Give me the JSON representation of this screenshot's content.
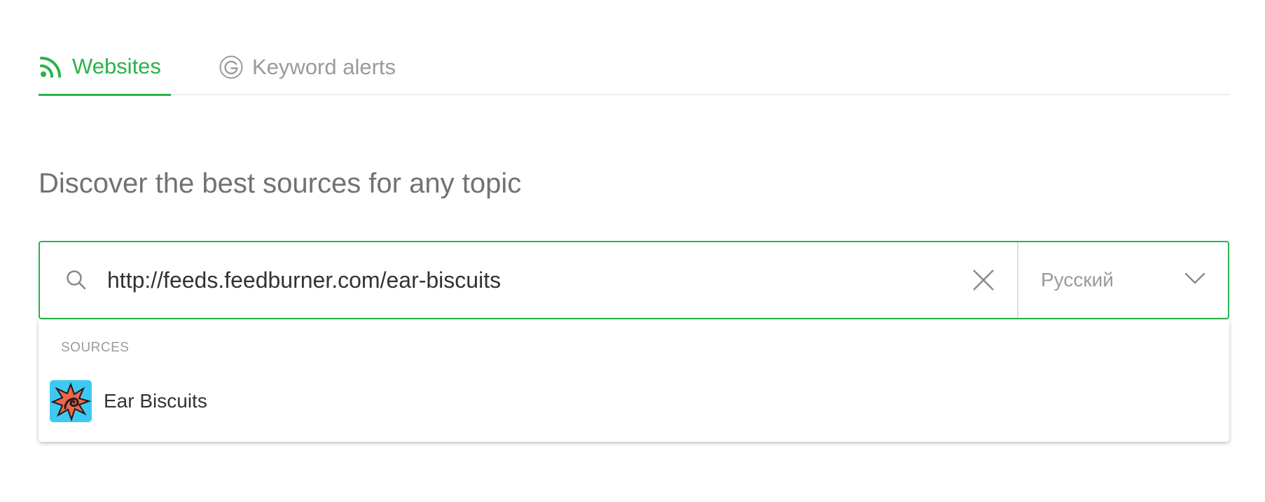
{
  "tabs": {
    "websites": {
      "label": "Websites",
      "icon": "rss-icon",
      "active": true
    },
    "keywords": {
      "label": "Keyword alerts",
      "icon": "google-icon",
      "active": false
    }
  },
  "heading": "Discover the best sources for any topic",
  "search": {
    "value": "http://feeds.feedburner.com/ear-biscuits",
    "icon": "search-icon",
    "clear_icon": "close-icon"
  },
  "language": {
    "selected": "Русский",
    "icon": "chevron-down-icon"
  },
  "dropdown": {
    "section_label": "SOURCES",
    "items": [
      {
        "name": "Ear Biscuits",
        "icon": "ear-biscuits-logo"
      }
    ]
  },
  "colors": {
    "accent": "#2bb24c",
    "muted": "#9a9a9a",
    "heading": "#727272",
    "text": "#333333"
  }
}
